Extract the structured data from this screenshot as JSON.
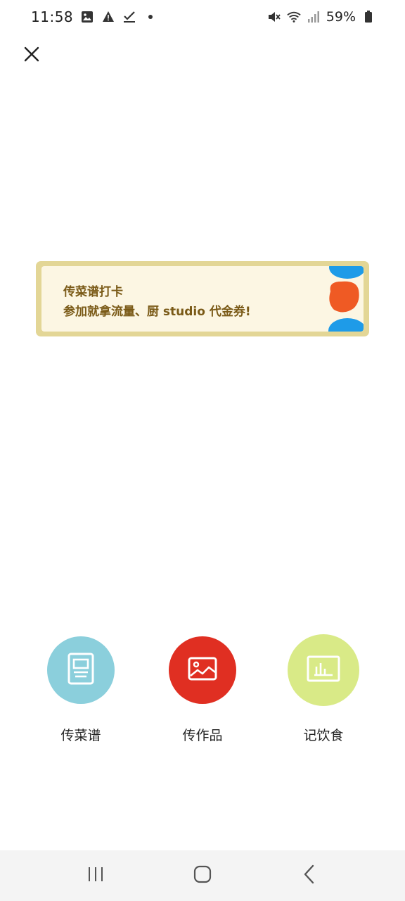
{
  "status_bar": {
    "time": "11:58",
    "battery_percent": "59%",
    "icons_left": [
      "gallery-icon",
      "warning-icon",
      "check-icon",
      "dot-icon"
    ],
    "icons_right": [
      "mute-icon",
      "wifi-icon",
      "signal-icon",
      "battery-icon"
    ]
  },
  "close_icon": "close-icon",
  "banner": {
    "line1": "传菜谱打卡",
    "line2": "参加就拿流量、厨 studio 代金券!",
    "colors": {
      "border": "#e3d696",
      "background": "#fcf6e3",
      "text": "#7a5a17",
      "blob_blue": "#1e9be8",
      "blob_orange": "#ef5a24"
    }
  },
  "actions": [
    {
      "label": "传菜谱",
      "icon": "recipe-icon",
      "color": "#8bcfdc"
    },
    {
      "label": "传作品",
      "icon": "image-icon",
      "color": "#e02f22"
    },
    {
      "label": "记饮食",
      "icon": "chart-icon",
      "color": "#d9ea87"
    }
  ],
  "nav_bar": {
    "buttons": [
      "recents-icon",
      "home-icon",
      "back-icon"
    ]
  }
}
